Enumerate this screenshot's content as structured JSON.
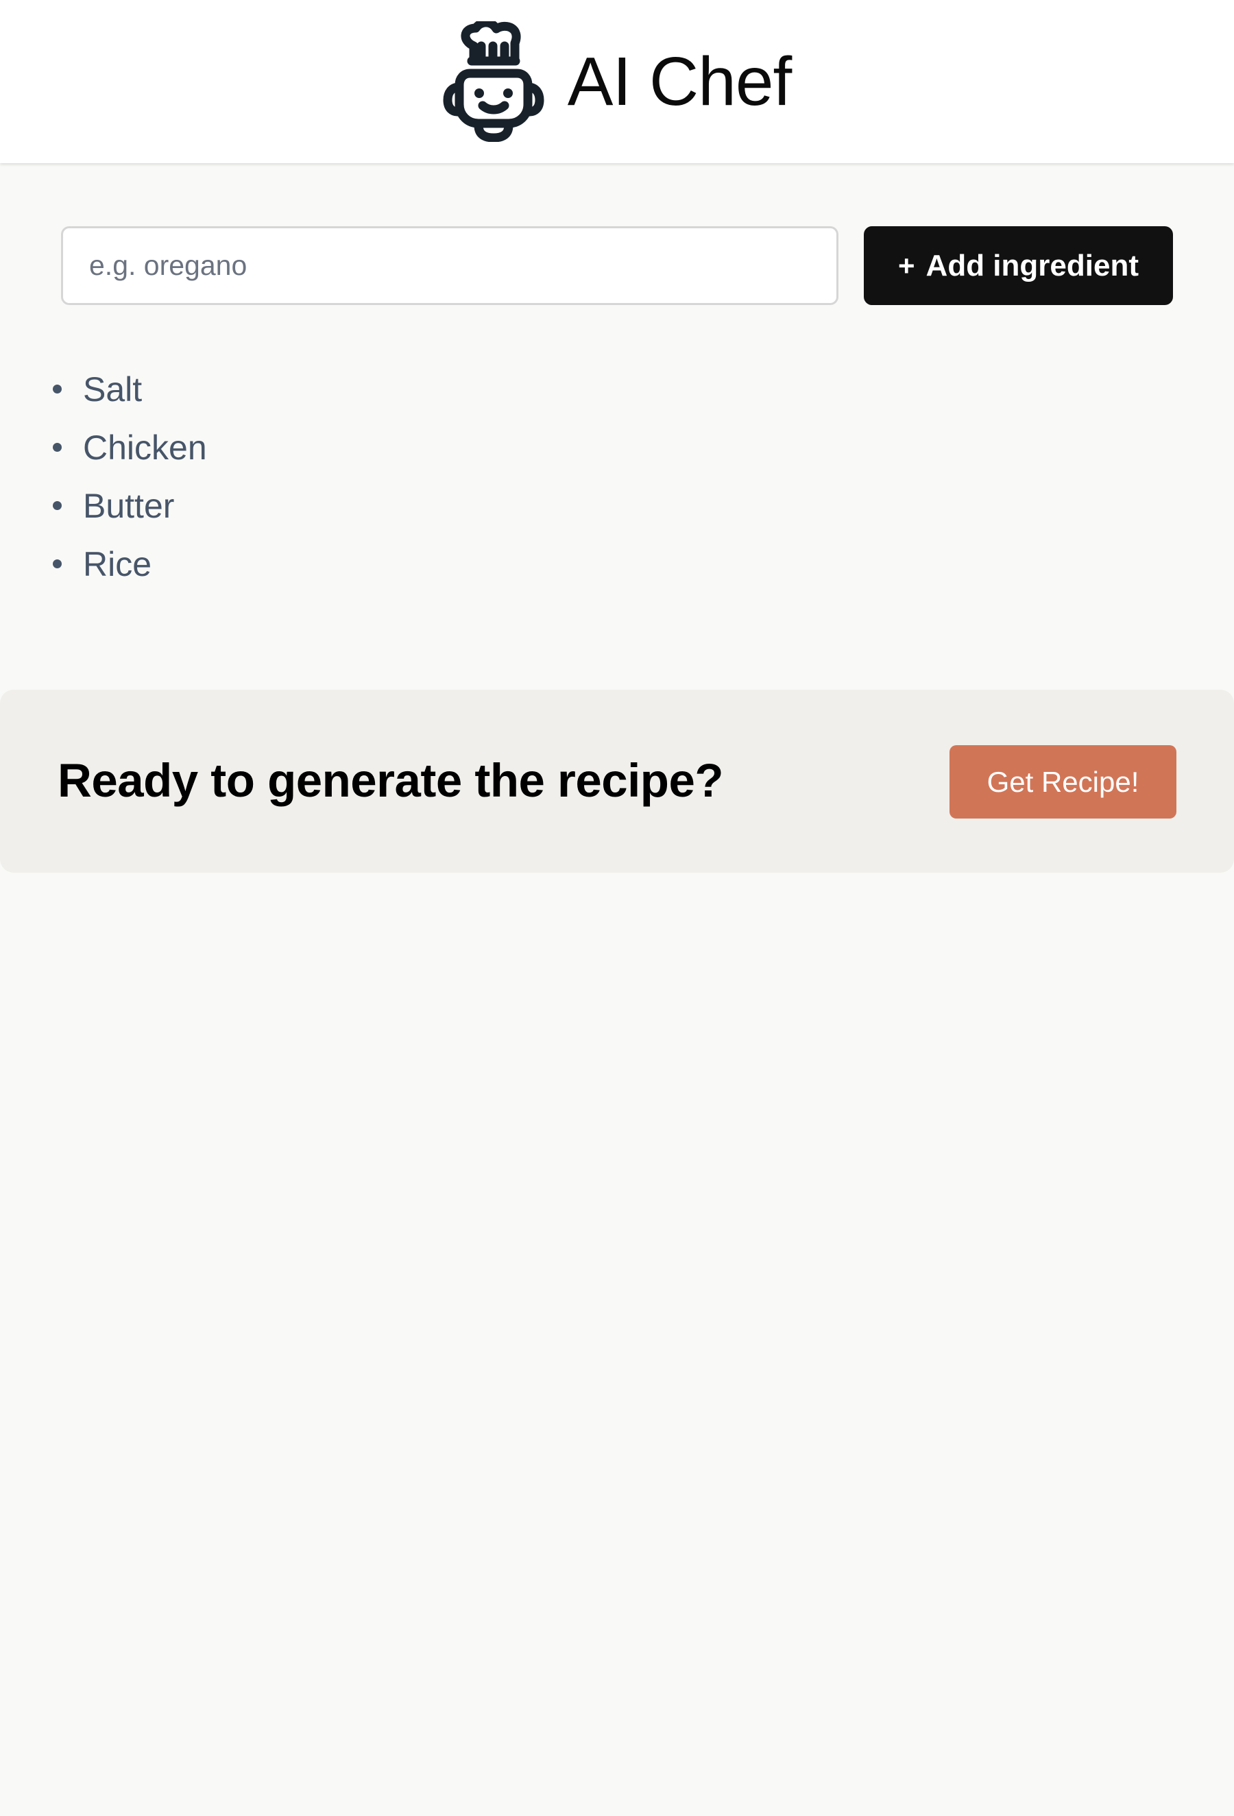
{
  "header": {
    "logo_icon": "chef-bot-icon",
    "title": "AI Chef"
  },
  "ingredient_form": {
    "input": {
      "value": "",
      "placeholder": "e.g. oregano"
    },
    "add_button": {
      "icon": "+",
      "label": "Add ingredient"
    }
  },
  "ingredients": [
    "Salt",
    "Chicken",
    "Butter",
    "Rice"
  ],
  "recipe_prompt": {
    "title": "Ready to generate the recipe?",
    "button_label": "Get Recipe!"
  },
  "colors": {
    "background": "#f9f9f7",
    "header_background": "#ffffff",
    "primary_button": "#111111",
    "accent_button": "#d17557",
    "ingredient_text": "#475569",
    "panel_background": "#f0efeb"
  }
}
